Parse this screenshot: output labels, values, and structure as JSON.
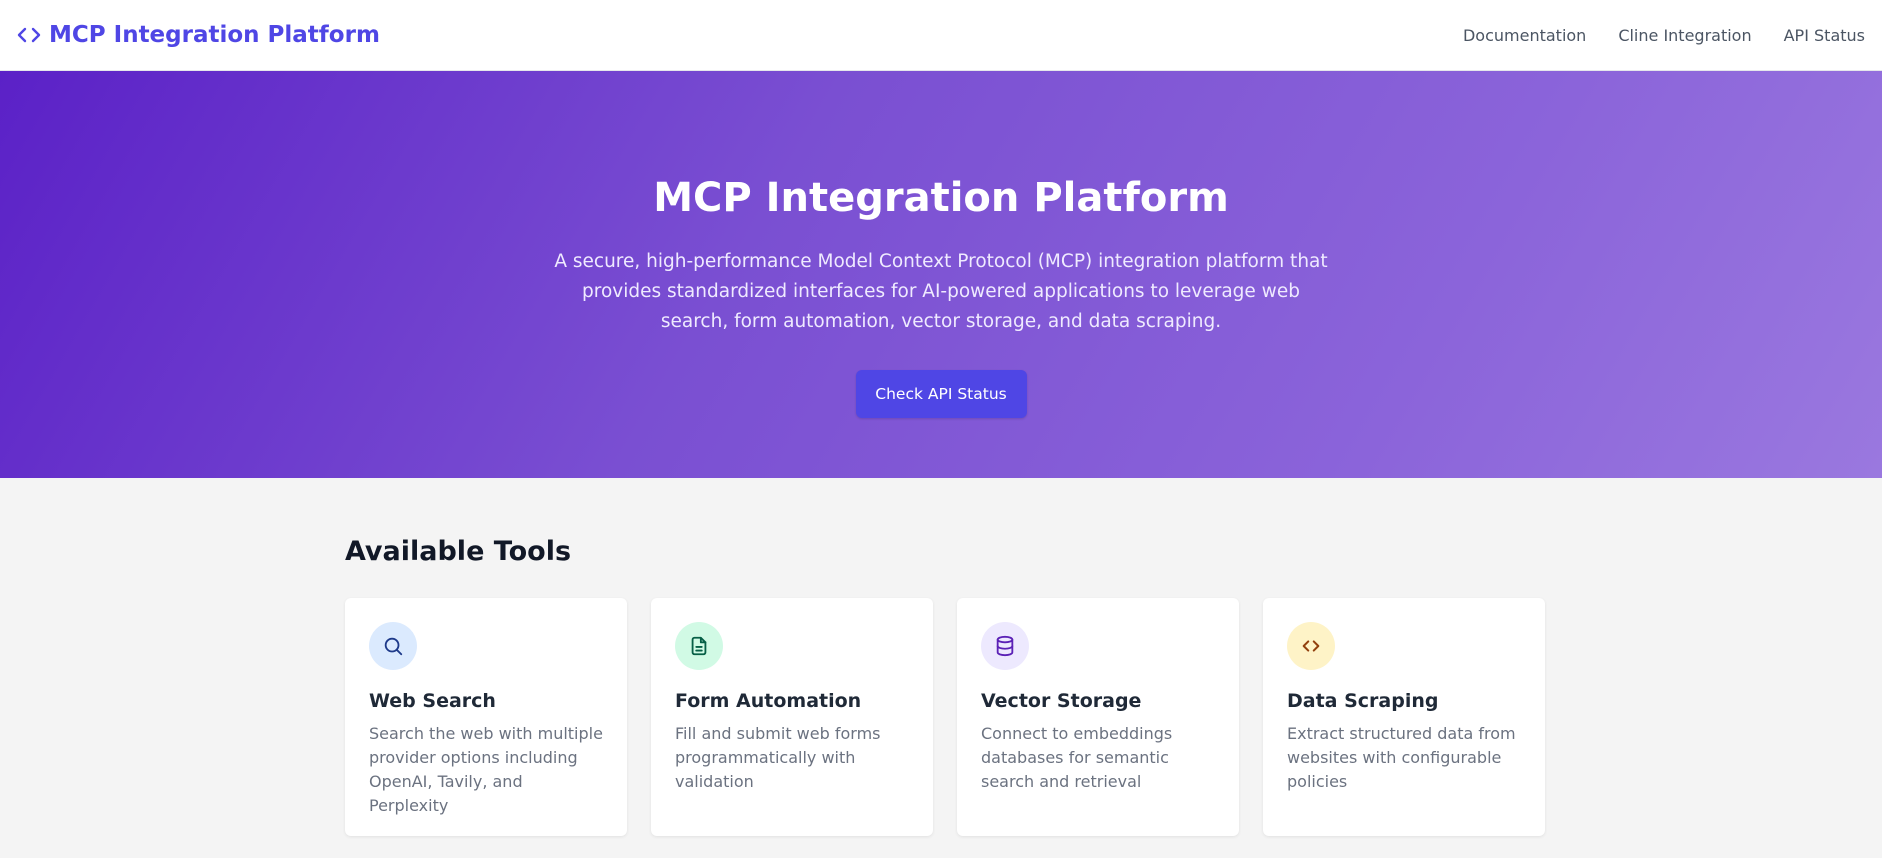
{
  "nav": {
    "brand_icon": "code-icon",
    "brand_title": "MCP Integration Platform",
    "links": [
      "Documentation",
      "Cline Integration",
      "API Status"
    ]
  },
  "hero": {
    "title": "MCP Integration Platform",
    "description": "A secure, high-performance Model Context Protocol (MCP) integration platform that provides standardized interfaces for AI-powered applications to leverage web search, form automation, vector storage, and data scraping.",
    "button_label": "Check API Status"
  },
  "tools": {
    "heading": "Available Tools",
    "cards": [
      {
        "icon": "search-icon",
        "title": "Web Search",
        "description": "Search the web with multiple provider options including OpenAI, Tavily, and Perplexity",
        "icon_bg": "#dbeafe",
        "icon_color": "#1e3a8a"
      },
      {
        "icon": "document-icon",
        "title": "Form Automation",
        "description": "Fill and submit web forms programmatically with validation",
        "icon_bg": "#d1fae5",
        "icon_color": "#065f46"
      },
      {
        "icon": "database-icon",
        "title": "Vector Storage",
        "description": "Connect to embeddings databases for semantic search and retrieval",
        "icon_bg": "#ede9fe",
        "icon_color": "#5b21b6"
      },
      {
        "icon": "code-icon",
        "title": "Data Scraping",
        "description": "Extract structured data from websites with configurable policies",
        "icon_bg": "#fef3c7",
        "icon_color": "#92400e"
      }
    ]
  },
  "colors": {
    "accent": "#4f46e5",
    "hero_gradient_start": "#5b21c7",
    "hero_gradient_end": "#9a78df",
    "page_background": "#f4f4f4"
  }
}
